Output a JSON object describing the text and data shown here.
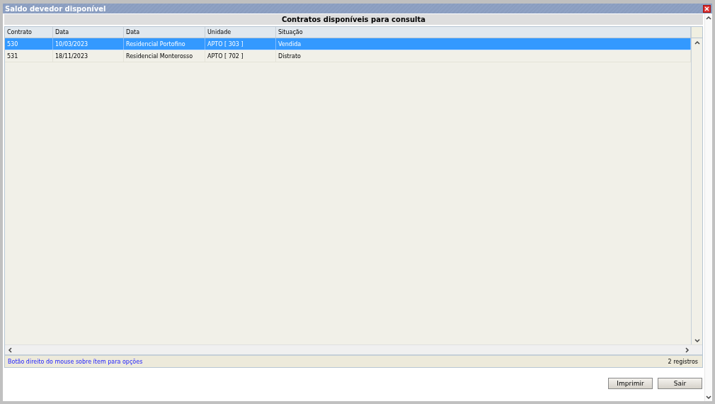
{
  "window": {
    "title": "Saldo devedor disponível"
  },
  "panel_title": "Contratos disponíveis para consulta",
  "table": {
    "columns": [
      "Contrato",
      "Data",
      "Data",
      "Unidade",
      "Situação"
    ],
    "rows": [
      {
        "cells": [
          "530",
          "10/03/2023",
          "Residencial Portofino",
          "APTO [ 303 ]",
          "Vendida"
        ],
        "selected": true
      },
      {
        "cells": [
          "531",
          "18/11/2023",
          "Residencial Monterosso",
          "APTO [ 702 ]",
          "Distrato"
        ],
        "selected": false
      }
    ]
  },
  "status_bar": {
    "hint": "Botão direito do mouse sobre ítem para opções",
    "count": "2 registros"
  },
  "buttons": [
    "Imprimir",
    "Sair"
  ]
}
